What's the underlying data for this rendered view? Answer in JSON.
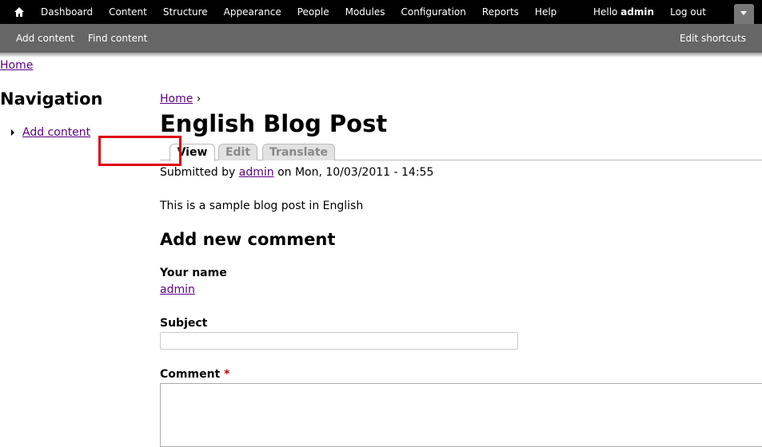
{
  "toolbar": {
    "menu": [
      "Dashboard",
      "Content",
      "Structure",
      "Appearance",
      "People",
      "Modules",
      "Configuration",
      "Reports",
      "Help"
    ],
    "hello_prefix": "Hello",
    "username": "admin",
    "logout": "Log out"
  },
  "shortcuts": {
    "items": [
      "Add content",
      "Find content"
    ],
    "edit": "Edit shortcuts"
  },
  "top_breadcrumb": "Home",
  "sidebar": {
    "title": "Navigation",
    "items": [
      {
        "label": "Add content"
      }
    ]
  },
  "main": {
    "breadcrumb": {
      "home": "Home",
      "separator": "›"
    },
    "title": "English Blog Post",
    "tabs": [
      {
        "label": "View",
        "active": true
      },
      {
        "label": "Edit",
        "active": false
      },
      {
        "label": "Translate",
        "active": false
      }
    ],
    "submitted": {
      "prefix": "Submitted by",
      "author": "admin",
      "date": "on Mon, 10/03/2011 - 14:55"
    },
    "body": "This is a sample blog post in English",
    "comment_form": {
      "heading": "Add new comment",
      "your_name_label": "Your name",
      "your_name_value": "admin",
      "subject_label": "Subject",
      "subject_value": "",
      "comment_label": "Comment",
      "required_marker": "*",
      "comment_value": ""
    }
  },
  "colors": {
    "toolbar_bg": "#000000",
    "shortcuts_bg": "#666666",
    "link": "#5b0080",
    "highlight": "#e0000b"
  }
}
